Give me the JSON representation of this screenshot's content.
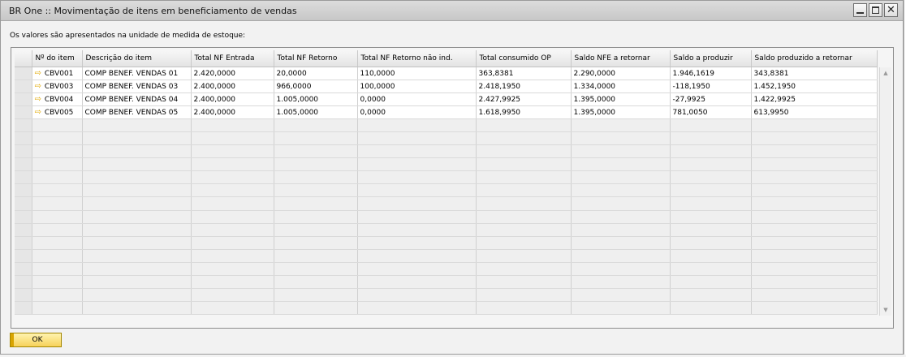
{
  "window": {
    "title": "BR One :: Movimentação de itens em beneficiamento de vendas"
  },
  "info_text": "Os valores são apresentados na unidade de medida de estoque:",
  "table": {
    "columns": [
      "Nº do item",
      "Descrição do item",
      "Total NF Entrada",
      "Total NF Retorno",
      "Total NF Retorno não ind.",
      "Total consumido OP",
      "Saldo NFE a retornar",
      "Saldo a produzir",
      "Saldo produzido a retornar"
    ],
    "rows": [
      [
        "CBV001",
        "COMP BENEF. VENDAS 01",
        "2.420,0000",
        "20,0000",
        "110,0000",
        "363,8381",
        "2.290,0000",
        "1.946,1619",
        "343,8381"
      ],
      [
        "CBV003",
        "COMP BENEF. VENDAS 03",
        "2.400,0000",
        "966,0000",
        "100,0000",
        "2.418,1950",
        "1.334,0000",
        "-118,1950",
        "1.452,1950"
      ],
      [
        "CBV004",
        "COMP BENEF. VENDAS 04",
        "2.400,0000",
        "1.005,0000",
        "0,0000",
        "2.427,9925",
        "1.395,0000",
        "-27,9925",
        "1.422,9925"
      ],
      [
        "CBV005",
        "COMP BENEF. VENDAS 05",
        "2.400,0000",
        "1.005,0000",
        "0,0000",
        "1.618,9950",
        "1.395,0000",
        "781,0050",
        "613,9950"
      ]
    ]
  },
  "ok_label": "OK",
  "icons": {
    "row_link": "link-arrow-icon",
    "scroll_up": "scroll-up-icon",
    "scroll_down": "scroll-down-icon"
  },
  "colors": {
    "ok_button": "#f7d25a",
    "link_arrow": "#e0a800"
  }
}
